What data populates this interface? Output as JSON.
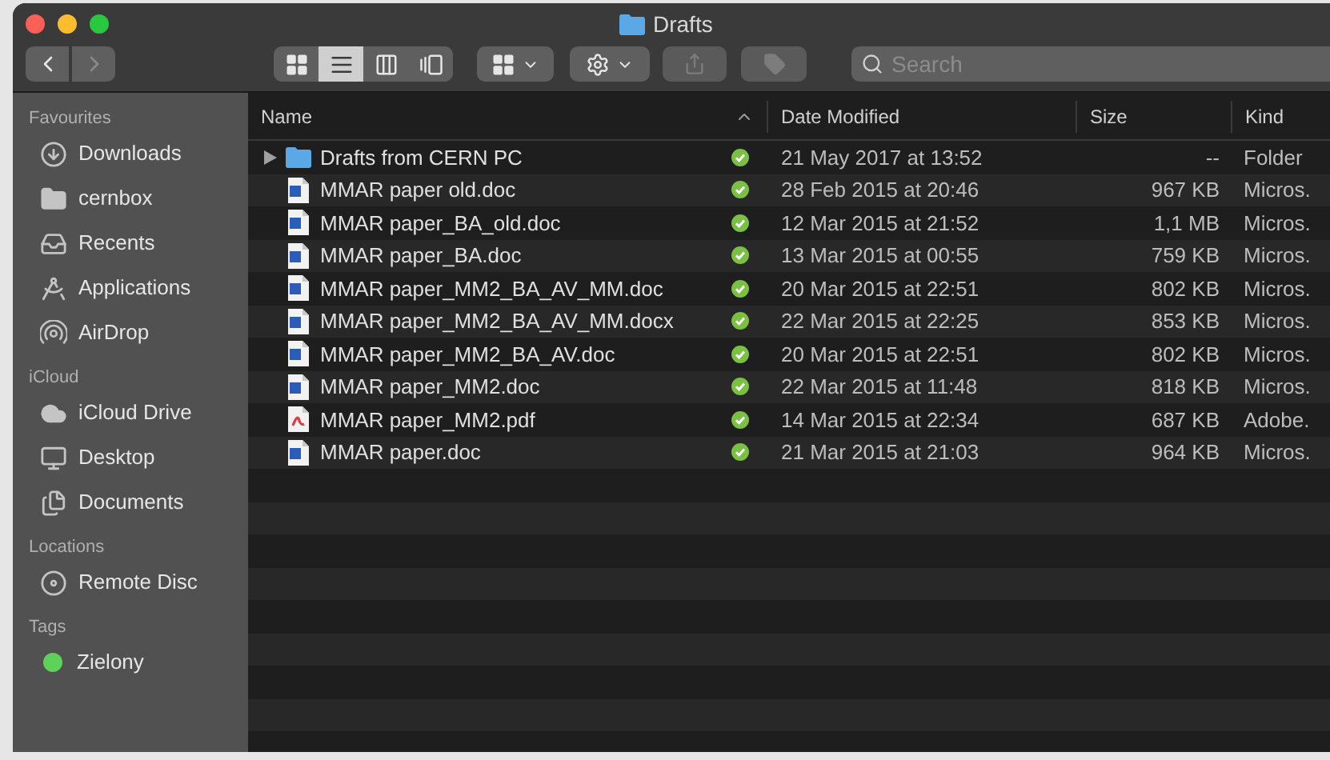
{
  "window": {
    "title": "Drafts"
  },
  "navigation": {
    "back_disabled": false,
    "forward_disabled": true
  },
  "toolbar": {
    "view_modes": [
      {
        "kind": "icons",
        "selected": false
      },
      {
        "kind": "list",
        "selected": true
      },
      {
        "kind": "columns",
        "selected": false
      },
      {
        "kind": "gallery",
        "selected": false
      }
    ],
    "buttons": [
      {
        "kind": "group",
        "disabled": false
      },
      {
        "kind": "action",
        "disabled": false
      },
      {
        "kind": "share",
        "disabled": true
      },
      {
        "kind": "tag",
        "disabled": true
      }
    ],
    "search": {
      "placeholder": "Search"
    }
  },
  "sidebar": {
    "sections": [
      {
        "title": "Favourites",
        "items": [
          {
            "label": "Downloads",
            "kind": "downloads"
          },
          {
            "label": "cernbox",
            "kind": "folder"
          },
          {
            "label": "Recents",
            "kind": "recents"
          },
          {
            "label": "Applications",
            "kind": "applications"
          },
          {
            "label": "AirDrop",
            "kind": "airdrop"
          }
        ]
      },
      {
        "title": "iCloud",
        "items": [
          {
            "label": "iCloud Drive",
            "kind": "cloud"
          },
          {
            "label": "Desktop",
            "kind": "desktop"
          },
          {
            "label": "Documents",
            "kind": "documents"
          }
        ]
      },
      {
        "title": "Locations",
        "items": [
          {
            "label": "Remote Disc",
            "kind": "disc"
          }
        ]
      },
      {
        "title": "Tags",
        "items": [
          {
            "label": "Zielony",
            "kind": "tag",
            "color": "#5ed15a"
          }
        ]
      }
    ]
  },
  "table": {
    "columns": [
      {
        "label": "Name",
        "sorted": true
      },
      {
        "label": "Date Modified",
        "sorted": false
      },
      {
        "label": "Size",
        "sorted": false
      },
      {
        "label": "Kind",
        "sorted": false
      }
    ],
    "rows": [
      {
        "name": "Drafts from CERN PC",
        "kind": "folder",
        "expanded": false,
        "synced": true,
        "date": "21 May 2017 at 13:52",
        "size": "--",
        "type": "Folder"
      },
      {
        "name": "MMAR paper old.doc",
        "kind": "doc",
        "synced": true,
        "date": "28 Feb 2015 at 20:46",
        "size": "967 KB",
        "type": "Micros."
      },
      {
        "name": "MMAR paper_BA_old.doc",
        "kind": "doc",
        "synced": true,
        "date": "12 Mar 2015 at 21:52",
        "size": "1,1 MB",
        "type": "Micros."
      },
      {
        "name": "MMAR paper_BA.doc",
        "kind": "doc",
        "synced": true,
        "date": "13 Mar 2015 at 00:55",
        "size": "759 KB",
        "type": "Micros."
      },
      {
        "name": "MMAR paper_MM2_BA_AV_MM.doc",
        "kind": "doc",
        "synced": true,
        "date": "20 Mar 2015 at 22:51",
        "size": "802 KB",
        "type": "Micros."
      },
      {
        "name": "MMAR paper_MM2_BA_AV_MM.docx",
        "kind": "doc",
        "synced": true,
        "date": "22 Mar 2015 at 22:25",
        "size": "853 KB",
        "type": "Micros."
      },
      {
        "name": "MMAR paper_MM2_BA_AV.doc",
        "kind": "doc",
        "synced": true,
        "date": "20 Mar 2015 at 22:51",
        "size": "802 KB",
        "type": "Micros."
      },
      {
        "name": "MMAR paper_MM2.doc",
        "kind": "doc",
        "synced": true,
        "date": "22 Mar 2015 at 11:48",
        "size": "818 KB",
        "type": "Micros."
      },
      {
        "name": "MMAR paper_MM2.pdf",
        "kind": "pdf",
        "synced": true,
        "date": "14 Mar 2015 at 22:34",
        "size": "687 KB",
        "type": "Adobe."
      },
      {
        "name": "MMAR paper.doc",
        "kind": "doc",
        "synced": true,
        "date": "21 Mar 2015 at 21:03",
        "size": "964 KB",
        "type": "Micros."
      }
    ]
  }
}
